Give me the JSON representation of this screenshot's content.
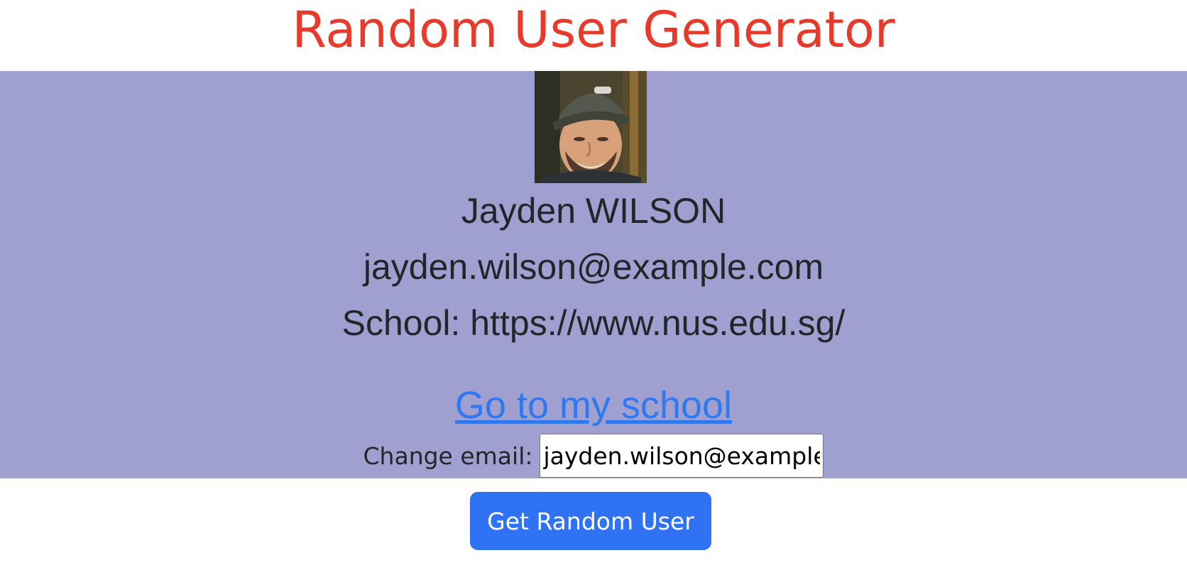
{
  "header": {
    "title": "Random User Generator"
  },
  "user": {
    "name": "Jayden WILSON",
    "email": "jayden.wilson@example.com",
    "school": "School: https://www.nus.edu.sg/",
    "school_link_label": "Go to my school",
    "avatar_icon": "user-photo"
  },
  "form": {
    "email_label": "Change email:",
    "email_value": "jayden.wilson@example.com"
  },
  "actions": {
    "random_button_label": "Get Random User"
  },
  "colors": {
    "title": "#e8392b",
    "card_background": "#a0a0d0",
    "link": "#2f78f0",
    "button": "#2f72f3"
  }
}
